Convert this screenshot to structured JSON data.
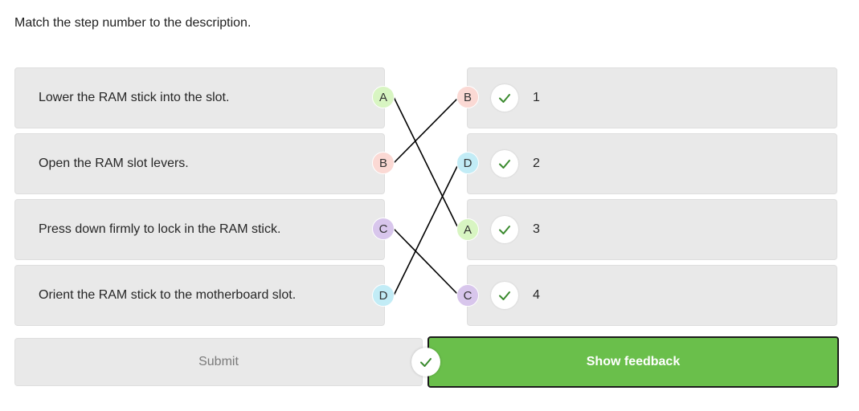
{
  "instruction": "Match the step number to the description.",
  "left_items": [
    {
      "text": "Lower the RAM stick into the slot.",
      "letter": "A"
    },
    {
      "text": "Open the RAM slot levers.",
      "letter": "B"
    },
    {
      "text": "Press down firmly to lock in the RAM stick.",
      "letter": "C"
    },
    {
      "text": "Orient the RAM stick to the motherboard slot.",
      "letter": "D"
    }
  ],
  "right_items": [
    {
      "number": "1",
      "letter": "B",
      "correct": true
    },
    {
      "number": "2",
      "letter": "D",
      "correct": true
    },
    {
      "number": "3",
      "letter": "A",
      "correct": true
    },
    {
      "number": "4",
      "letter": "C",
      "correct": true
    }
  ],
  "letter_colors": {
    "A": "#d8f5c2",
    "B": "#fbd9d4",
    "C": "#d8c6ec",
    "D": "#c2ecf6"
  },
  "check_color": "#3a8a2e",
  "buttons": {
    "submit": "Submit",
    "show_feedback": "Show feedback"
  },
  "feedback_button_color": "#6abf4b"
}
